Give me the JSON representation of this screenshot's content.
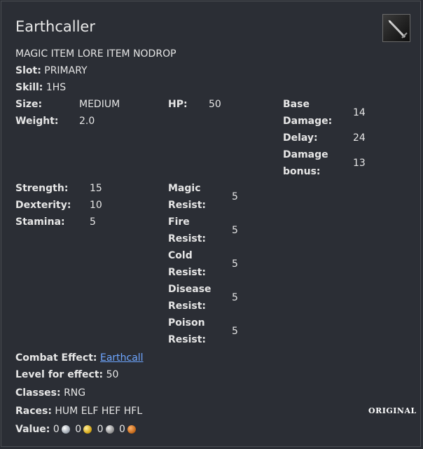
{
  "item": {
    "name": "Earthcaller",
    "icon": "sword-icon",
    "flags": "MAGIC ITEM LORE ITEM NODROP"
  },
  "info": {
    "slot_label": "Slot:",
    "slot_value": "PRIMARY",
    "skill_label": "Skill:",
    "skill_value": "1HS",
    "size_label": "Size:",
    "size_value": "MEDIUM",
    "weight_label": "Weight:",
    "weight_value": "2.0",
    "hp_label": "HP:",
    "hp_value": "50",
    "base_damage_label_1": "Base",
    "base_damage_label_2": "Damage:",
    "base_damage_value": "14",
    "delay_label": "Delay:",
    "delay_value": "24",
    "damage_bonus_label_1": "Damage",
    "damage_bonus_label_2": "bonus:",
    "damage_bonus_value": "13"
  },
  "stats": {
    "strength_label": "Strength:",
    "strength_value": "15",
    "dexterity_label": "Dexterity:",
    "dexterity_value": "10",
    "stamina_label": "Stamina:",
    "stamina_value": "5"
  },
  "resists": [
    {
      "label_1": "Magic",
      "label_2": "Resist:",
      "value": "5"
    },
    {
      "label_1": "Fire",
      "label_2": "Resist:",
      "value": "5"
    },
    {
      "label_1": "Cold",
      "label_2": "Resist:",
      "value": "5"
    },
    {
      "label_1": "Disease",
      "label_2": "Resist:",
      "value": "5"
    },
    {
      "label_1": "Poison",
      "label_2": "Resist:",
      "value": "5"
    }
  ],
  "effects": {
    "combat_effect_label": "Combat Effect:",
    "combat_effect_link": "Earthcall",
    "level_label": "Level for effect:",
    "level_value": "50",
    "classes_label": "Classes:",
    "classes_value": "RNG",
    "races_label": "Races:",
    "races_value": "HUM ELF HEF HFL",
    "value_label": "Value:",
    "platinum": "0",
    "gold": "0",
    "silver": "0",
    "copper": "0"
  },
  "watermark": "ORIGINAL",
  "colors": {
    "background": "#2b2e35",
    "text": "#e6e6e6",
    "link": "#6ea6ff"
  }
}
